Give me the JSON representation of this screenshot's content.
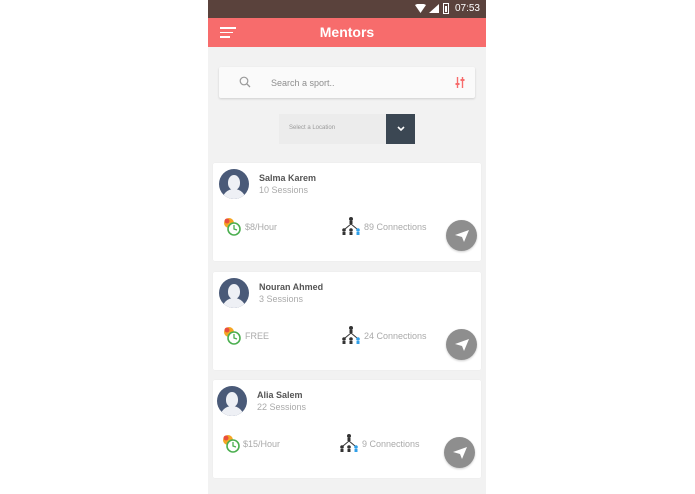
{
  "status_bar": {
    "time": "07:53"
  },
  "app_bar": {
    "title": "Mentors"
  },
  "search": {
    "placeholder": "Search a sport.."
  },
  "location": {
    "placeholder": "Select a Location"
  },
  "mentors": [
    {
      "name": "Salma Karem",
      "sessions": "10 Sessions",
      "rate": "$8/Hour",
      "connections": "89 Connections"
    },
    {
      "name": "Nouran Ahmed",
      "sessions": "3 Sessions",
      "rate": "FREE",
      "connections": "24 Connections"
    },
    {
      "name": "Alia Salem",
      "sessions": "22 Sessions",
      "rate": "$15/Hour",
      "connections": "9 Connections"
    }
  ],
  "colors": {
    "accent": "#f76c6c",
    "status_bar": "#5a423c",
    "dropdown": "#3b4753",
    "avatar": "#4a5a78"
  }
}
